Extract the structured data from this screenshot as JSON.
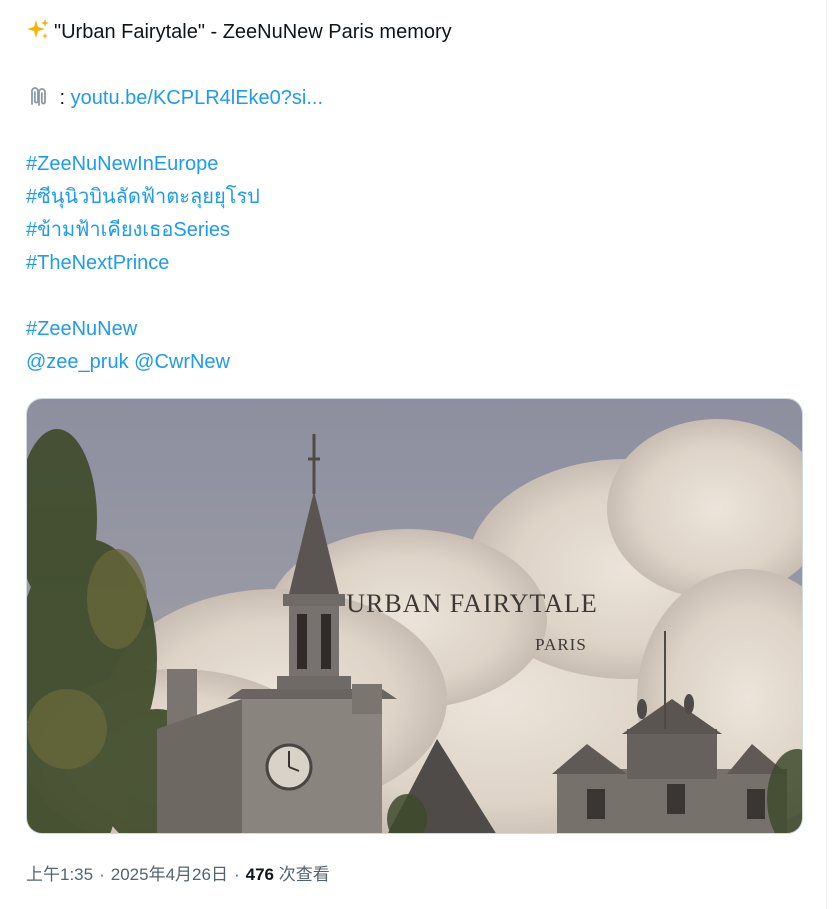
{
  "tweet": {
    "line1_emoji": "sparkles-icon",
    "line1_text": "\"Urban Fairytale\" - ZeeNuNew Paris memory",
    "link_emoji": "paperclips-icon",
    "link_prefix": " : ",
    "link_text": "youtu.be/KCPLR4lEke0?si...",
    "hashtags": [
      "#ZeeNuNewInEurope",
      "#ซีนุนิวบินลัดฟ้าตะลุยยุโรป",
      "#ข้ามฟ้าเคียงเธอSeries",
      "#TheNextPrince"
    ],
    "hashtag_main": "#ZeeNuNew",
    "mentions": [
      "@zee_pruk",
      "@CwrNew"
    ]
  },
  "media": {
    "title": "URBAN FAIRYTALE",
    "subtitle": "PARIS"
  },
  "meta": {
    "time": "上午1:35",
    "date": "2025年4月26日",
    "views_count": "476",
    "views_label": "次查看"
  },
  "colors": {
    "link": "#1d9bf0",
    "text": "#0f1419",
    "secondary": "#536471"
  }
}
